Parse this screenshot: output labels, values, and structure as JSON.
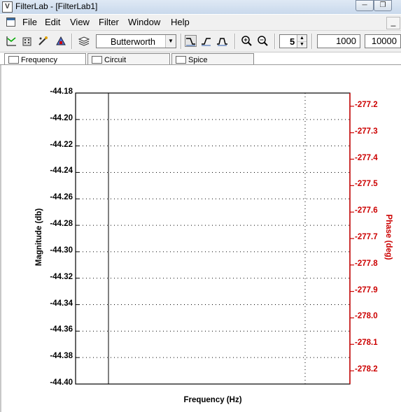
{
  "window": {
    "title": "FilterLab - [FilterLab1]",
    "app_icon_glyph": "V"
  },
  "menu": {
    "items": [
      "File",
      "Edit",
      "View",
      "Filter",
      "Window",
      "Help"
    ]
  },
  "toolbar": {
    "filter_type": "Butterworth",
    "order": "5",
    "freq_start": "1000",
    "freq_end": "10000"
  },
  "tabs": [
    "Frequency",
    "Circuit",
    "Spice"
  ],
  "chart_data": {
    "type": "line",
    "xlabel": "Frequency (Hz)",
    "ylabel": "Magnitude (db)",
    "y2label": "Phase (deg)",
    "ylim": [
      -44.4,
      -44.18
    ],
    "y2lim": [
      -278.25,
      -277.15
    ],
    "yticks": [
      "-44.18",
      "-44.20",
      "-44.22",
      "-44.24",
      "-44.26",
      "-44.28",
      "-44.30",
      "-44.32",
      "-44.34",
      "-44.36",
      "-44.38",
      "-44.40"
    ],
    "y2ticks": [
      "-277.2",
      "-277.3",
      "-277.4",
      "-277.5",
      "-277.6",
      "-277.7",
      "-277.8",
      "-277.9",
      "-278.0",
      "-278.1",
      "-278.2"
    ],
    "grid": true,
    "series": [
      {
        "color": "#000000",
        "values": []
      },
      {
        "color": "#cc0000",
        "values": []
      }
    ]
  },
  "colors": {
    "phase": "#cc0000",
    "magnitude": "#000000"
  }
}
